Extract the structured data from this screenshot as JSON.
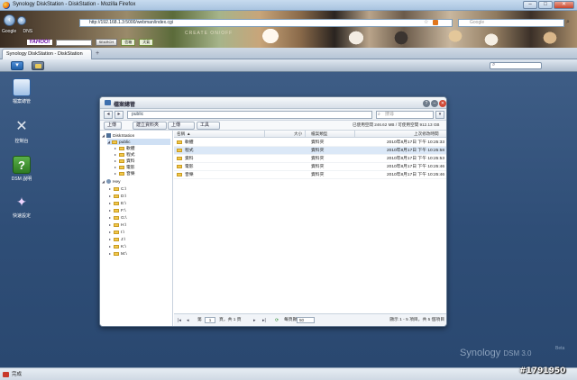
{
  "browser": {
    "window_title": "Synology DiskStation - DiskStation - Mozilla Firefox",
    "url": "http://192.168.1.3:5000/webman/index.cgi",
    "search_placeholder": "Google",
    "bookmark_items": [
      "Google",
      "DNS"
    ],
    "yahoo": {
      "logo": "YAHOO!",
      "search_label": "SEARCH",
      "button_1": "信箱",
      "button_2": "天氣"
    },
    "persona_watermark": "CREATE ON/OFF",
    "tab_title": "Synology DiskStation - DiskStation",
    "status_text": "完成",
    "window_buttons": {
      "minimize": "–",
      "maximize": "□",
      "close": "✕"
    }
  },
  "dsm": {
    "desktop_icons": [
      {
        "label": "檔案總管",
        "icon": "file-station-icon"
      },
      {
        "label": "控制台",
        "icon": "control-panel-icon"
      },
      {
        "label": "DSM 說明",
        "icon": "help-icon"
      },
      {
        "label": "快速設定",
        "icon": "wizard-icon"
      }
    ],
    "brand": "Synology",
    "brand_sub": "DSM 3.0",
    "brand_beta": "Beta"
  },
  "file_station": {
    "title": "檔案總管",
    "path": "public",
    "search_placeholder": "搜尋",
    "toolbar": {
      "upload": "上傳",
      "new_folder": "建立資料夾",
      "action": "上傳",
      "tools": "工具"
    },
    "quota": "已使用空間 246.62 MB / 可使用空間 912.13 GB",
    "tree": [
      {
        "label": "DiskStation",
        "level": 0,
        "kind": "server",
        "expanded": true
      },
      {
        "label": "public",
        "level": 1,
        "kind": "folder",
        "selected": true,
        "expanded": true
      },
      {
        "label": "軟體",
        "level": 2,
        "kind": "folder"
      },
      {
        "label": "程式",
        "level": 2,
        "kind": "folder"
      },
      {
        "label": "資料",
        "level": 2,
        "kind": "folder"
      },
      {
        "label": "電影",
        "level": 2,
        "kind": "folder"
      },
      {
        "label": "音樂",
        "level": 2,
        "kind": "folder"
      },
      {
        "label": "Hey",
        "level": 0,
        "kind": "user",
        "expanded": true
      },
      {
        "label": "C:\\",
        "level": 1,
        "kind": "folder"
      },
      {
        "label": "D:\\",
        "level": 1,
        "kind": "folder"
      },
      {
        "label": "E:\\",
        "level": 1,
        "kind": "folder"
      },
      {
        "label": "F:\\",
        "level": 1,
        "kind": "folder"
      },
      {
        "label": "G:\\",
        "level": 1,
        "kind": "folder"
      },
      {
        "label": "H:\\",
        "level": 1,
        "kind": "folder"
      },
      {
        "label": "I:\\",
        "level": 1,
        "kind": "folder"
      },
      {
        "label": "J:\\",
        "level": 1,
        "kind": "folder"
      },
      {
        "label": "K:\\",
        "level": 1,
        "kind": "folder"
      },
      {
        "label": "M:\\",
        "level": 1,
        "kind": "folder"
      }
    ],
    "columns": {
      "name": "名稱",
      "size": "大小",
      "type": "檔案類型",
      "modified": "上次修改時間"
    },
    "rows": [
      {
        "name": "軟體",
        "size": "",
        "type": "資料夾",
        "modified": "2010年8月17日 下午 10:25:33",
        "selected": false
      },
      {
        "name": "程式",
        "size": "",
        "type": "資料夾",
        "modified": "2010年8月17日 下午 10:25:58",
        "selected": true
      },
      {
        "name": "資料",
        "size": "",
        "type": "資料夾",
        "modified": "2010年8月17日 下午 10:25:53",
        "selected": false
      },
      {
        "name": "電影",
        "size": "",
        "type": "資料夾",
        "modified": "2010年8月17日 下午 10:25:46",
        "selected": false
      },
      {
        "name": "音樂",
        "size": "",
        "type": "資料夾",
        "modified": "2010年8月17日 下午 10:25:46",
        "selected": false
      }
    ],
    "pager": {
      "page_prefix": "第",
      "page_value": "1",
      "page_suffix": "頁，共 1 頁",
      "page_size_label": "每頁顯示數",
      "page_size": "50",
      "display_info": "顯示 1 - 5 項目，共 5 個項目"
    }
  },
  "watermark": "#1791950"
}
